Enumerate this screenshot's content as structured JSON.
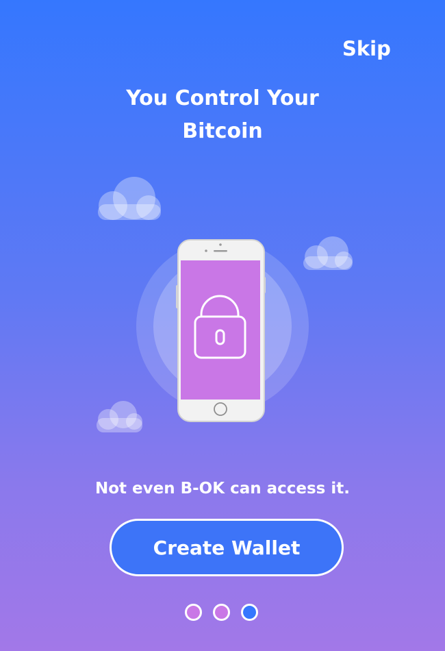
{
  "header": {
    "skip_label": "Skip"
  },
  "onboarding": {
    "title_line1": "You Control Your",
    "title_line2": "Bitcoin",
    "subtitle": "Not even B-OK can access it.",
    "cta_label": "Create Wallet",
    "illustration": {
      "icons": [
        "cloud-icon",
        "cloud-icon",
        "cloud-icon",
        "smartphone-icon",
        "padlock-icon"
      ]
    }
  },
  "pagination": {
    "page_count": 3,
    "active_index": 2
  },
  "colors": {
    "gradient_top": "#3577FE",
    "gradient_bottom": "#A278E8",
    "button_fill": "#3D74F8",
    "phone_screen": "#C977E6",
    "inactive_dot": "#C977E6",
    "active_dot": "#3577FE",
    "text": "#FFFFFF"
  }
}
